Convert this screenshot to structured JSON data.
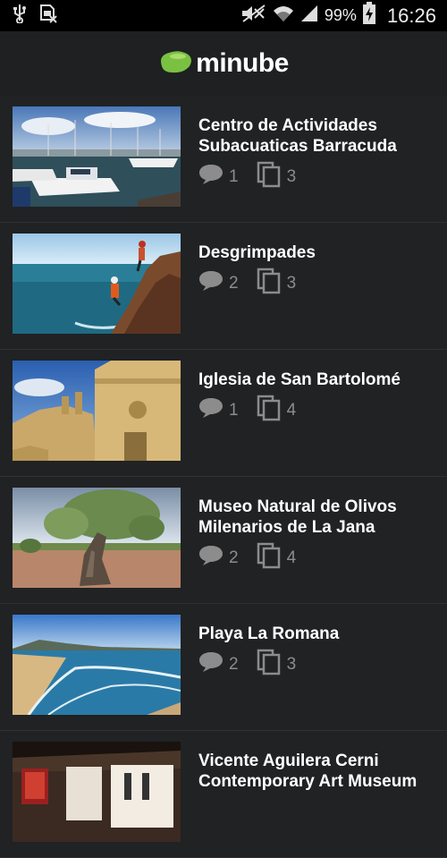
{
  "status_bar": {
    "battery": "99%",
    "time": "16:26"
  },
  "app": {
    "logo_text": "minube"
  },
  "places": [
    {
      "title": "Centro de Actividades Subacuaticas Barracuda",
      "comments": "1",
      "photos": "3",
      "image": "marina with boats"
    },
    {
      "title": "Desgrimpades",
      "comments": "2",
      "photos": "3",
      "image": "climbers on sea cliff"
    },
    {
      "title": "Iglesia de San Bartolomé",
      "comments": "1",
      "photos": "4",
      "image": "church bell tower"
    },
    {
      "title": "Museo Natural de Olivos Milenarios de La Jana",
      "comments": "2",
      "photos": "4",
      "image": "ancient olive tree"
    },
    {
      "title": "Playa La Romana",
      "comments": "2",
      "photos": "3",
      "image": "beach coastline"
    },
    {
      "title": "Vicente Aguilera Cerni Contemporary Art Museum",
      "comments": "",
      "photos": "",
      "image": "art museum interior"
    }
  ],
  "icons": {
    "comment": "comment-bubble-icon",
    "photos": "photo-stack-icon"
  },
  "colors": {
    "background": "#202224",
    "logo_green": "#7ac142",
    "stat_gray": "#8c8c8c"
  }
}
